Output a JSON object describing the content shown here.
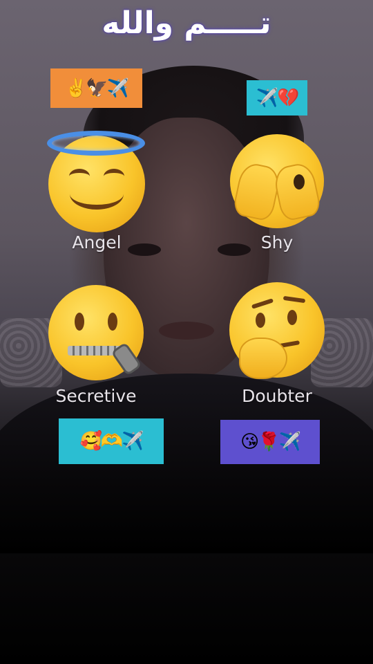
{
  "title": "تـــــم والله",
  "chips": {
    "top_left": "✌️🦅✈️",
    "top_right": "✈️💔",
    "bottom_left": "🥰🫶✈️",
    "bottom_right": "😘🌹✈️"
  },
  "filter_options": [
    {
      "label": "Angel",
      "icon": "smiling-halo-icon"
    },
    {
      "label": "Shy",
      "icon": "peeking-hands-icon"
    },
    {
      "label": "Secretive",
      "icon": "zipper-mouth-icon"
    },
    {
      "label": "Doubter",
      "icon": "thinking-face-icon"
    }
  ],
  "colors": {
    "chip_orange": "#f18e3a",
    "chip_cyan": "#2bbed2",
    "chip_purple": "#5e50cf",
    "title_glow": "#5a46c8"
  }
}
